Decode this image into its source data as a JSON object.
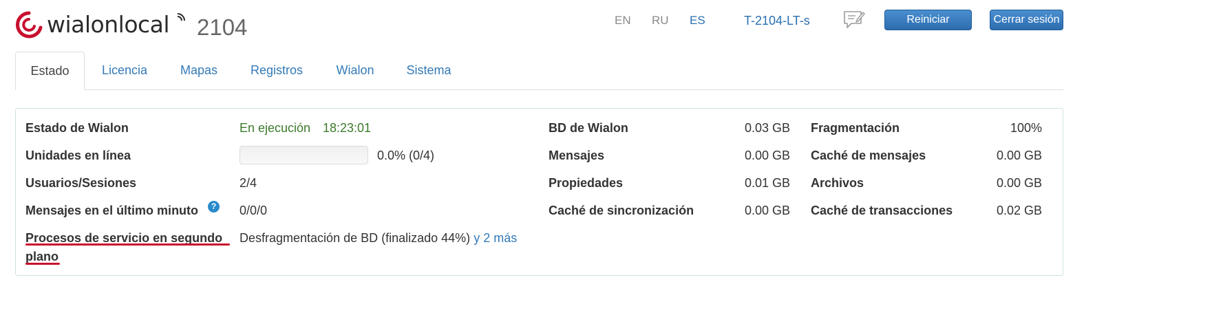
{
  "header": {
    "logo_text": "wialonlocal",
    "version": "2104",
    "languages": [
      {
        "code": "EN",
        "active": false
      },
      {
        "code": "RU",
        "active": false
      },
      {
        "code": "ES",
        "active": true
      }
    ],
    "host": "T-2104-LT-s",
    "chat_icon": "chat-edit-icon",
    "restart_label": "Reiniciar",
    "logout_label": "Cerrar sesión"
  },
  "tabs": [
    {
      "label": "Estado",
      "active": true
    },
    {
      "label": "Licencia",
      "active": false
    },
    {
      "label": "Mapas",
      "active": false
    },
    {
      "label": "Registros",
      "active": false
    },
    {
      "label": "Wialon",
      "active": false
    },
    {
      "label": "Sistema",
      "active": false
    }
  ],
  "status": {
    "wialon_state": {
      "label": "Estado de Wialon",
      "value": "En ejecución",
      "uptime": "18:23:01"
    },
    "units_online": {
      "label": "Unidades en línea",
      "value": "0.0% (0/4)",
      "fraction": 0.0
    },
    "users_sessions": {
      "label": "Usuarios/Sesiones",
      "value": "2/4"
    },
    "messages_last_minute": {
      "label": "Mensajes en el último minuto",
      "value": "0/0/0",
      "help_icon": "help-icon"
    },
    "background_processes": {
      "label_line1": "Procesos de servicio en segundo",
      "label_line2": "plano",
      "value": "Desfragmentación de BD (finalizado 44%)",
      "more_link": "y 2 más"
    }
  },
  "db_stats": [
    {
      "label": "BD de Wialon",
      "value": "0.03 GB"
    },
    {
      "label": "Mensajes",
      "value": "0.00 GB"
    },
    {
      "label": "Propiedades",
      "value": "0.01 GB"
    },
    {
      "label": "Caché de sincronización",
      "value": "0.00 GB"
    }
  ],
  "storage_stats": [
    {
      "label": "Fragmentación",
      "value": "100%"
    },
    {
      "label": "Caché de mensajes",
      "value": "0.00 GB"
    },
    {
      "label": "Archivos",
      "value": "0.00 GB"
    },
    {
      "label": "Caché de transacciones",
      "value": "0.02 GB"
    }
  ],
  "colors": {
    "accent": "#337ab7",
    "running": "#3c7a2b",
    "button": "#2d6db0",
    "underline": "#c8102e"
  }
}
